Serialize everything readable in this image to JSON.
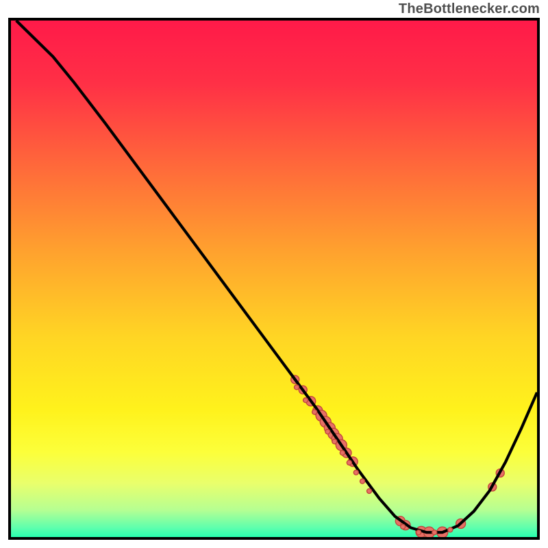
{
  "attribution": "TheBottlenecker.com",
  "gradient_stops": [
    {
      "offset": 0.0,
      "color": "#ff1a49"
    },
    {
      "offset": 0.12,
      "color": "#ff3046"
    },
    {
      "offset": 0.28,
      "color": "#ff6a3a"
    },
    {
      "offset": 0.44,
      "color": "#ffa22e"
    },
    {
      "offset": 0.6,
      "color": "#ffd524"
    },
    {
      "offset": 0.74,
      "color": "#fff21c"
    },
    {
      "offset": 0.82,
      "color": "#fcff3a"
    },
    {
      "offset": 0.88,
      "color": "#e9ff6c"
    },
    {
      "offset": 0.93,
      "color": "#b6ff92"
    },
    {
      "offset": 0.965,
      "color": "#5cffae"
    },
    {
      "offset": 0.985,
      "color": "#1effb0"
    },
    {
      "offset": 1.0,
      "color": "#0cff9c"
    }
  ],
  "chart_data": {
    "type": "line",
    "title": "",
    "xlabel": "",
    "ylabel": "",
    "xlim": [
      0,
      100
    ],
    "ylim": [
      0,
      100
    ],
    "curve": [
      {
        "x": 1,
        "y": 100
      },
      {
        "x": 4,
        "y": 97
      },
      {
        "x": 8,
        "y": 93
      },
      {
        "x": 12,
        "y": 88
      },
      {
        "x": 18,
        "y": 80
      },
      {
        "x": 26,
        "y": 69
      },
      {
        "x": 34,
        "y": 58
      },
      {
        "x": 42,
        "y": 47
      },
      {
        "x": 50,
        "y": 36
      },
      {
        "x": 54,
        "y": 30.5
      },
      {
        "x": 58,
        "y": 25
      },
      {
        "x": 62,
        "y": 19
      },
      {
        "x": 66,
        "y": 13
      },
      {
        "x": 70,
        "y": 7.5
      },
      {
        "x": 73,
        "y": 4
      },
      {
        "x": 76,
        "y": 1.8
      },
      {
        "x": 79,
        "y": 0.9
      },
      {
        "x": 82,
        "y": 0.9
      },
      {
        "x": 85,
        "y": 2.2
      },
      {
        "x": 88,
        "y": 5
      },
      {
        "x": 91,
        "y": 9
      },
      {
        "x": 94,
        "y": 14.5
      },
      {
        "x": 97,
        "y": 21
      },
      {
        "x": 100,
        "y": 28
      }
    ],
    "big_dots": [
      {
        "x": 54.0,
        "y": 30.5,
        "r": 6
      },
      {
        "x": 55.5,
        "y": 28.5,
        "r": 6
      },
      {
        "x": 57.0,
        "y": 26.3,
        "r": 7
      },
      {
        "x": 58.3,
        "y": 24.5,
        "r": 7
      },
      {
        "x": 59.0,
        "y": 23.5,
        "r": 8
      },
      {
        "x": 59.8,
        "y": 22.3,
        "r": 8
      },
      {
        "x": 60.6,
        "y": 21.1,
        "r": 8
      },
      {
        "x": 61.3,
        "y": 20.0,
        "r": 8
      },
      {
        "x": 62.0,
        "y": 19.0,
        "r": 8
      },
      {
        "x": 62.8,
        "y": 17.8,
        "r": 8
      },
      {
        "x": 63.8,
        "y": 16.3,
        "r": 7
      },
      {
        "x": 65.0,
        "y": 14.6,
        "r": 7
      },
      {
        "x": 74.0,
        "y": 3.1,
        "r": 7
      },
      {
        "x": 75.0,
        "y": 2.3,
        "r": 7
      },
      {
        "x": 78.0,
        "y": 1.0,
        "r": 8
      },
      {
        "x": 79.5,
        "y": 0.9,
        "r": 8
      },
      {
        "x": 82.0,
        "y": 0.9,
        "r": 8
      },
      {
        "x": 85.5,
        "y": 2.6,
        "r": 7
      },
      {
        "x": 91.5,
        "y": 9.7,
        "r": 6
      },
      {
        "x": 93.0,
        "y": 12.4,
        "r": 6
      }
    ],
    "small_dots": [
      {
        "x": 54.3,
        "y": 29.0,
        "r": 3.5
      },
      {
        "x": 56.0,
        "y": 26.5,
        "r": 3.5
      },
      {
        "x": 57.7,
        "y": 24.2,
        "r": 3.5
      },
      {
        "x": 60.2,
        "y": 20.4,
        "r": 3.5
      },
      {
        "x": 61.5,
        "y": 18.5,
        "r": 3.5
      },
      {
        "x": 63.0,
        "y": 16.3,
        "r": 3.5
      },
      {
        "x": 64.3,
        "y": 14.4,
        "r": 3.5
      },
      {
        "x": 65.6,
        "y": 12.5,
        "r": 3.5
      },
      {
        "x": 66.8,
        "y": 10.8,
        "r": 3.5
      },
      {
        "x": 68.1,
        "y": 8.9,
        "r": 3.5
      },
      {
        "x": 74.5,
        "y": 2.0,
        "r": 3.5
      },
      {
        "x": 77.5,
        "y": 0.9,
        "r": 3.5
      },
      {
        "x": 80.5,
        "y": 0.9,
        "r": 3.5
      },
      {
        "x": 83.5,
        "y": 1.4,
        "r": 3.5
      }
    ],
    "dot_fill": "#e77066",
    "dot_stroke": "#c0463c",
    "curve_stroke": "#000000"
  }
}
